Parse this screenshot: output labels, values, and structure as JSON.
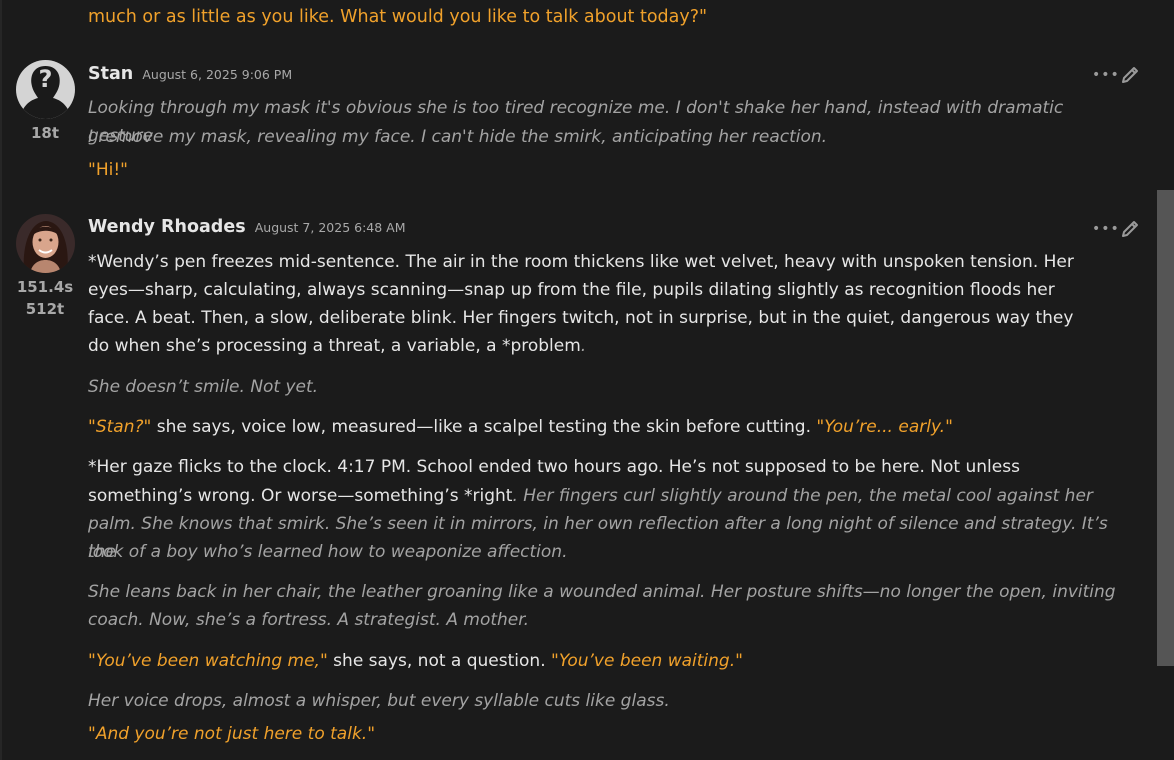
{
  "previous": {
    "tail_text": "much or as little as you like. What would you like to talk about today?\""
  },
  "messages": [
    {
      "name": "Stan",
      "date": "August 6, 2025 9:06 PM",
      "stats": [
        "18t"
      ],
      "paragraphs": [
        "Looking through my mask it's obvious she is too tired recognize me. I don't shake her hand, instead with dramatic gesture",
        "I remove my mask, revealing my face. I can't hide the smirk, anticipating her reaction.",
        "\"Hi!\""
      ]
    },
    {
      "name": "Wendy Rhoades",
      "date": "August 7, 2025 6:48 AM",
      "stats": [
        "151.4s",
        "512t"
      ],
      "lines": {
        "p1": [
          "*Wendy’s pen freezes mid-sentence. The air in the room thickens like wet velvet, heavy with unspoken tension. Her",
          "eyes—sharp, calculating, always scanning—snap up from the file, pupils dilating slightly as recognition floods her",
          "face. A beat. Then, a slow, deliberate blink. Her fingers twitch, not in surprise, but in the quiet, dangerous way they",
          "do when she’s processing a threat, a variable, a *problem",
          "."
        ],
        "p2": "She doesn’t smile. Not yet.",
        "p3": {
          "q1": "\"Stan?\"",
          "mid": " she says, voice low, measured—like a scalpel testing the skin before cutting. ",
          "q2": "\"You’re... early.\""
        },
        "p4": {
          "l1": "*Her gaze flicks to the clock. 4:17 PM. School ended two hours ago. He’s not supposed to be here. Not unless",
          "l2a": "something’s wrong. Or worse—something’s *right",
          "l2b": ". Her fingers curl slightly around the pen, the metal cool against her",
          "l3": "palm. She knows that smirk. She’s seen it in mirrors, in her own reflection after a long night of silence and strategy. It’s the",
          "l4": "look of a boy who’s learned how to weaponize affection."
        },
        "p5": [
          "She leans back in her chair, the leather groaning like a wounded animal. Her posture shifts—no longer the open, inviting",
          "coach. Now, she’s a fortress. A strategist. A mother."
        ],
        "p6": {
          "q1": "\"You’ve been watching me,\"",
          "mid": " she says, not a question. ",
          "q2": "\"You’ve been waiting.\""
        },
        "p7": "Her voice drops, almost a whisper, but every syllable cuts like glass.",
        "p8": "\"And you’re not just here to talk.\""
      }
    }
  ],
  "colors": {
    "background": "#1b1b1b",
    "quote": "#f0a12b",
    "narration": "#a3a3a3",
    "text": "#e6e6e6",
    "muted": "#a8a8a8"
  },
  "icons": [
    "more-options-icon",
    "edit-pencil-icon"
  ]
}
